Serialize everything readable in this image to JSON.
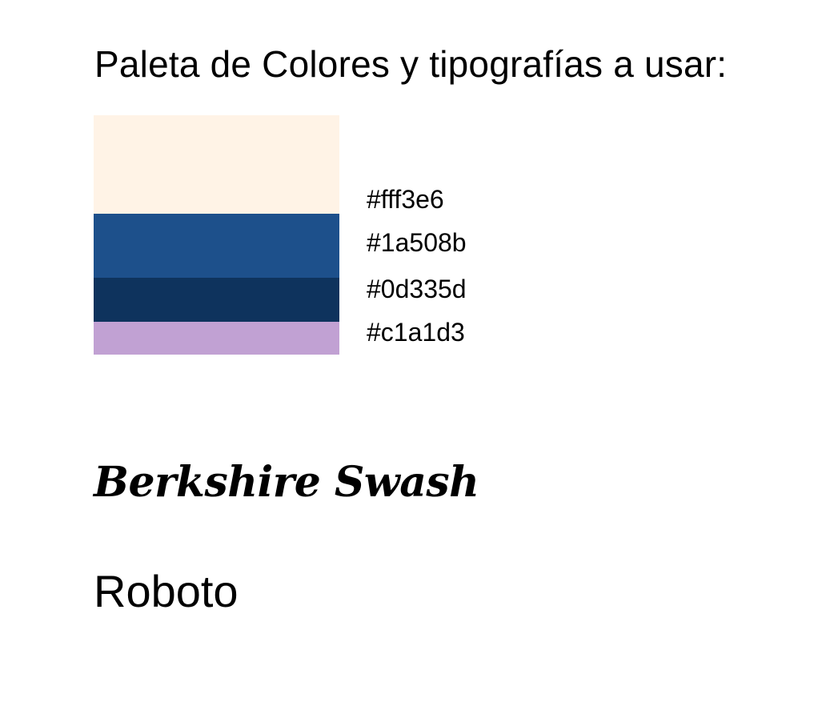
{
  "title": "Paleta de Colores y tipografías a usar:",
  "palette": [
    {
      "hex": "#fff3e6",
      "label": "#fff3e6"
    },
    {
      "hex": "#1d508b",
      "label": "#1a508b"
    },
    {
      "hex": "#0e335d",
      "label": "#0d335d"
    },
    {
      "hex": "#c1a1d3",
      "label": "#c1a1d3"
    }
  ],
  "fonts": {
    "display_sample": "Berkshire Swash",
    "body_sample": "Roboto"
  }
}
